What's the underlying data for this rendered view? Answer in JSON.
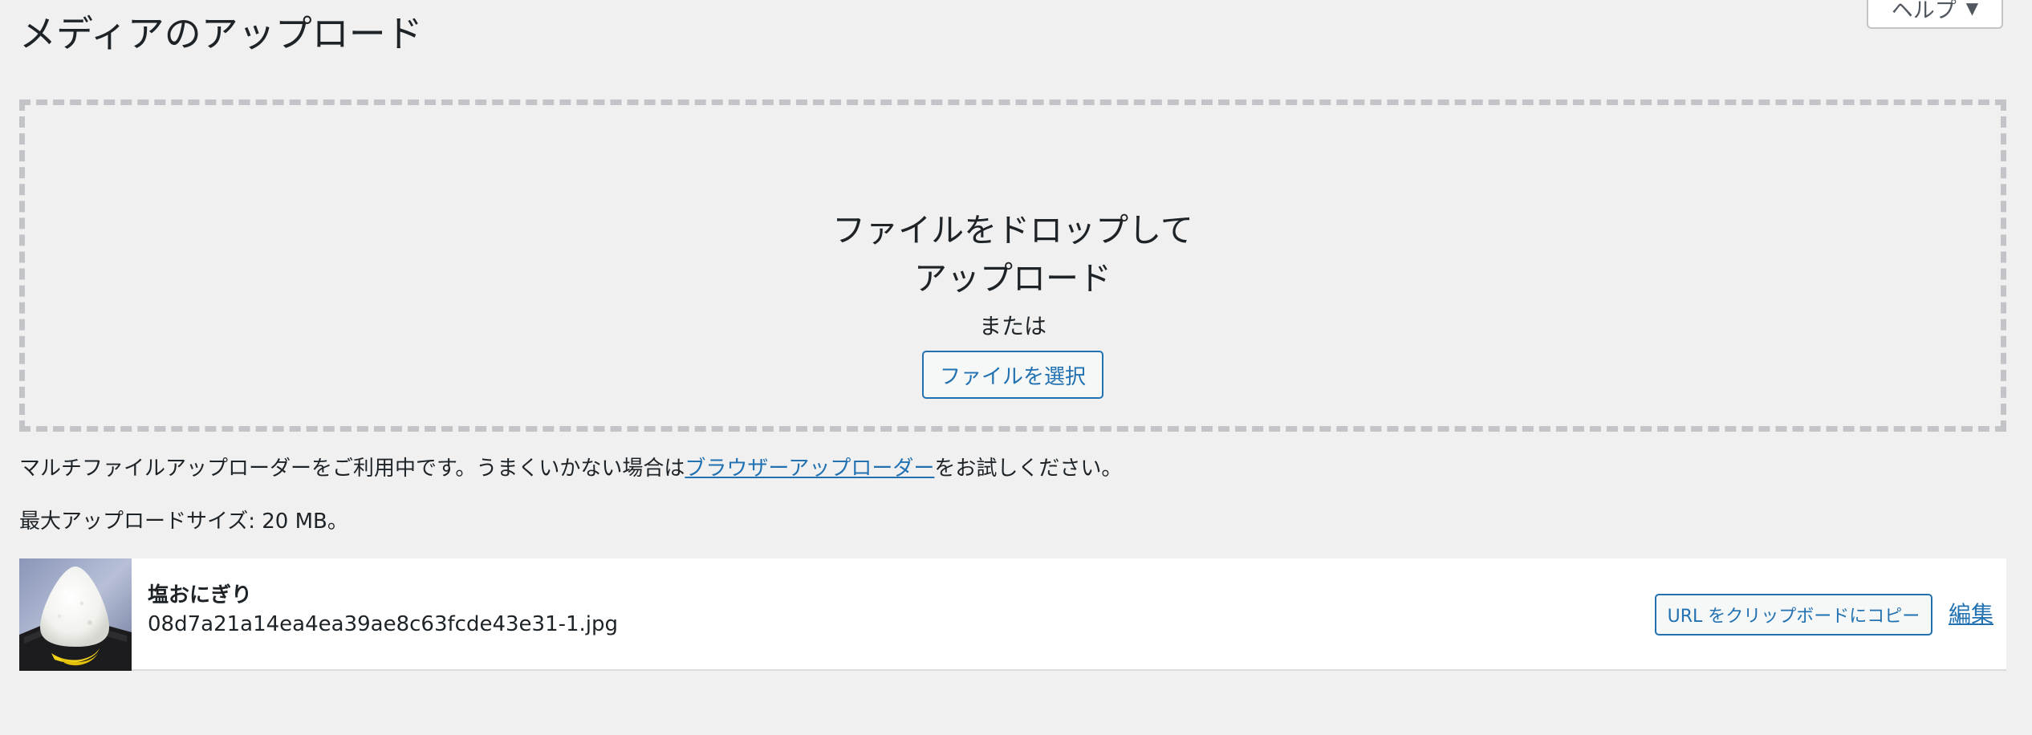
{
  "header": {
    "title": "メディアのアップロード",
    "help_label": "ヘルプ",
    "help_arrow_icon": "triangle-down"
  },
  "uploader": {
    "drop_title": "ファイルをドロップしてアップロード",
    "or_text": "または",
    "select_button": "ファイルを選択"
  },
  "info": {
    "multi_prefix": "マルチファイルアップローダーをご利用中です。うまくいかない場合は",
    "browser_uploader_link": "ブラウザーアップローダー",
    "multi_suffix": "をお試しください。",
    "max_size": "最大アップロードサイズ: 20 MB。"
  },
  "media_item": {
    "title": "塩おにぎり",
    "filename": "08d7a21a14ea4ea39ae8c63fcde43e31-1.jpg",
    "copy_button": "URL をクリップボードにコピー",
    "edit_link": "編集"
  },
  "colors": {
    "background": "#f0f0f1",
    "accent": "#2271b1",
    "text": "#1d2327",
    "dashed_border": "#c3c4c7"
  }
}
